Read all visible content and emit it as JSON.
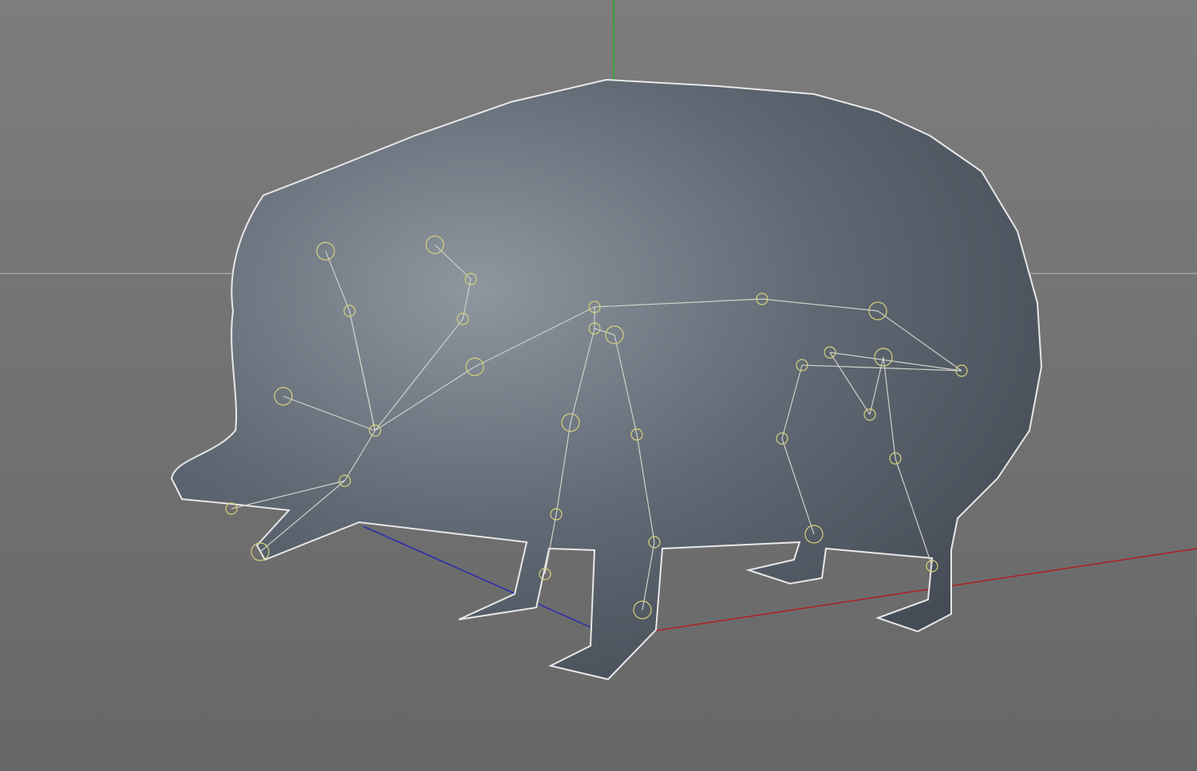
{
  "viewport": {
    "view": "perspective",
    "model": "hedgehog",
    "colors": {
      "background_top": "#7d7d7d",
      "background_bottom": "#686868",
      "horizon": "#b8b8b8",
      "axis_x": "#b02020",
      "axis_y": "#22b022",
      "axis_z": "#2a2ab0",
      "mesh": "#5a6470",
      "mesh_outline": "#e8e8e8",
      "bone": "#d0d0c8",
      "joint": "#d8d27a"
    }
  }
}
